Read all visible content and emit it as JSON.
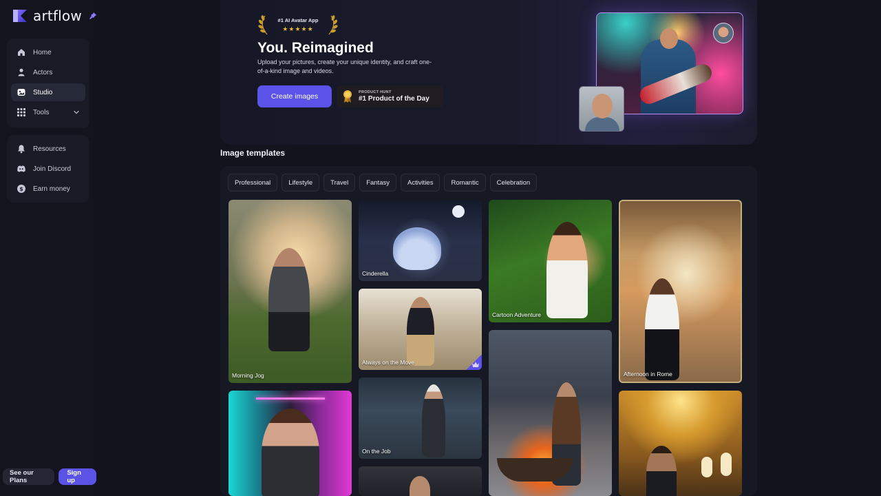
{
  "brand": {
    "name": "artflow",
    "accent": "#5b52e8"
  },
  "sidebar": {
    "main_items": [
      {
        "label": "Home",
        "icon": "home-icon"
      },
      {
        "label": "Actors",
        "icon": "user-icon"
      },
      {
        "label": "Studio",
        "icon": "studio-icon",
        "active": true
      },
      {
        "label": "Tools",
        "icon": "grid-icon"
      }
    ],
    "secondary_items": [
      {
        "label": "Resources",
        "icon": "bell-icon"
      },
      {
        "label": "Join Discord",
        "icon": "discord-icon"
      },
      {
        "label": "Earn money",
        "icon": "dollar-icon"
      }
    ],
    "see_plans_label": "See our Plans",
    "signup_label": "Sign up"
  },
  "hero": {
    "award_text": "#1 AI Avatar App",
    "award_stars": "★★★★★",
    "title": "You. Reimagined",
    "subtitle": "Upload your pictures, create your unique identity, and craft one-of-a-kind image and videos.",
    "create_button": "Create images",
    "product_hunt_small": "PRODUCT HUNT",
    "product_hunt_big": "#1 Product of the Day"
  },
  "templates": {
    "title": "Image templates",
    "categories": [
      "Professional",
      "Lifestyle",
      "Travel",
      "Fantasy",
      "Activities",
      "Romantic",
      "Celebration"
    ],
    "cards": [
      {
        "label": "Morning Jog"
      },
      {
        "label": "Cinderella"
      },
      {
        "label": "Always on the Move",
        "premium": true
      },
      {
        "label": "On the Job"
      },
      {
        "label": "Cartoon Adventure"
      },
      {
        "label": "Afternoon in Rome"
      }
    ]
  }
}
